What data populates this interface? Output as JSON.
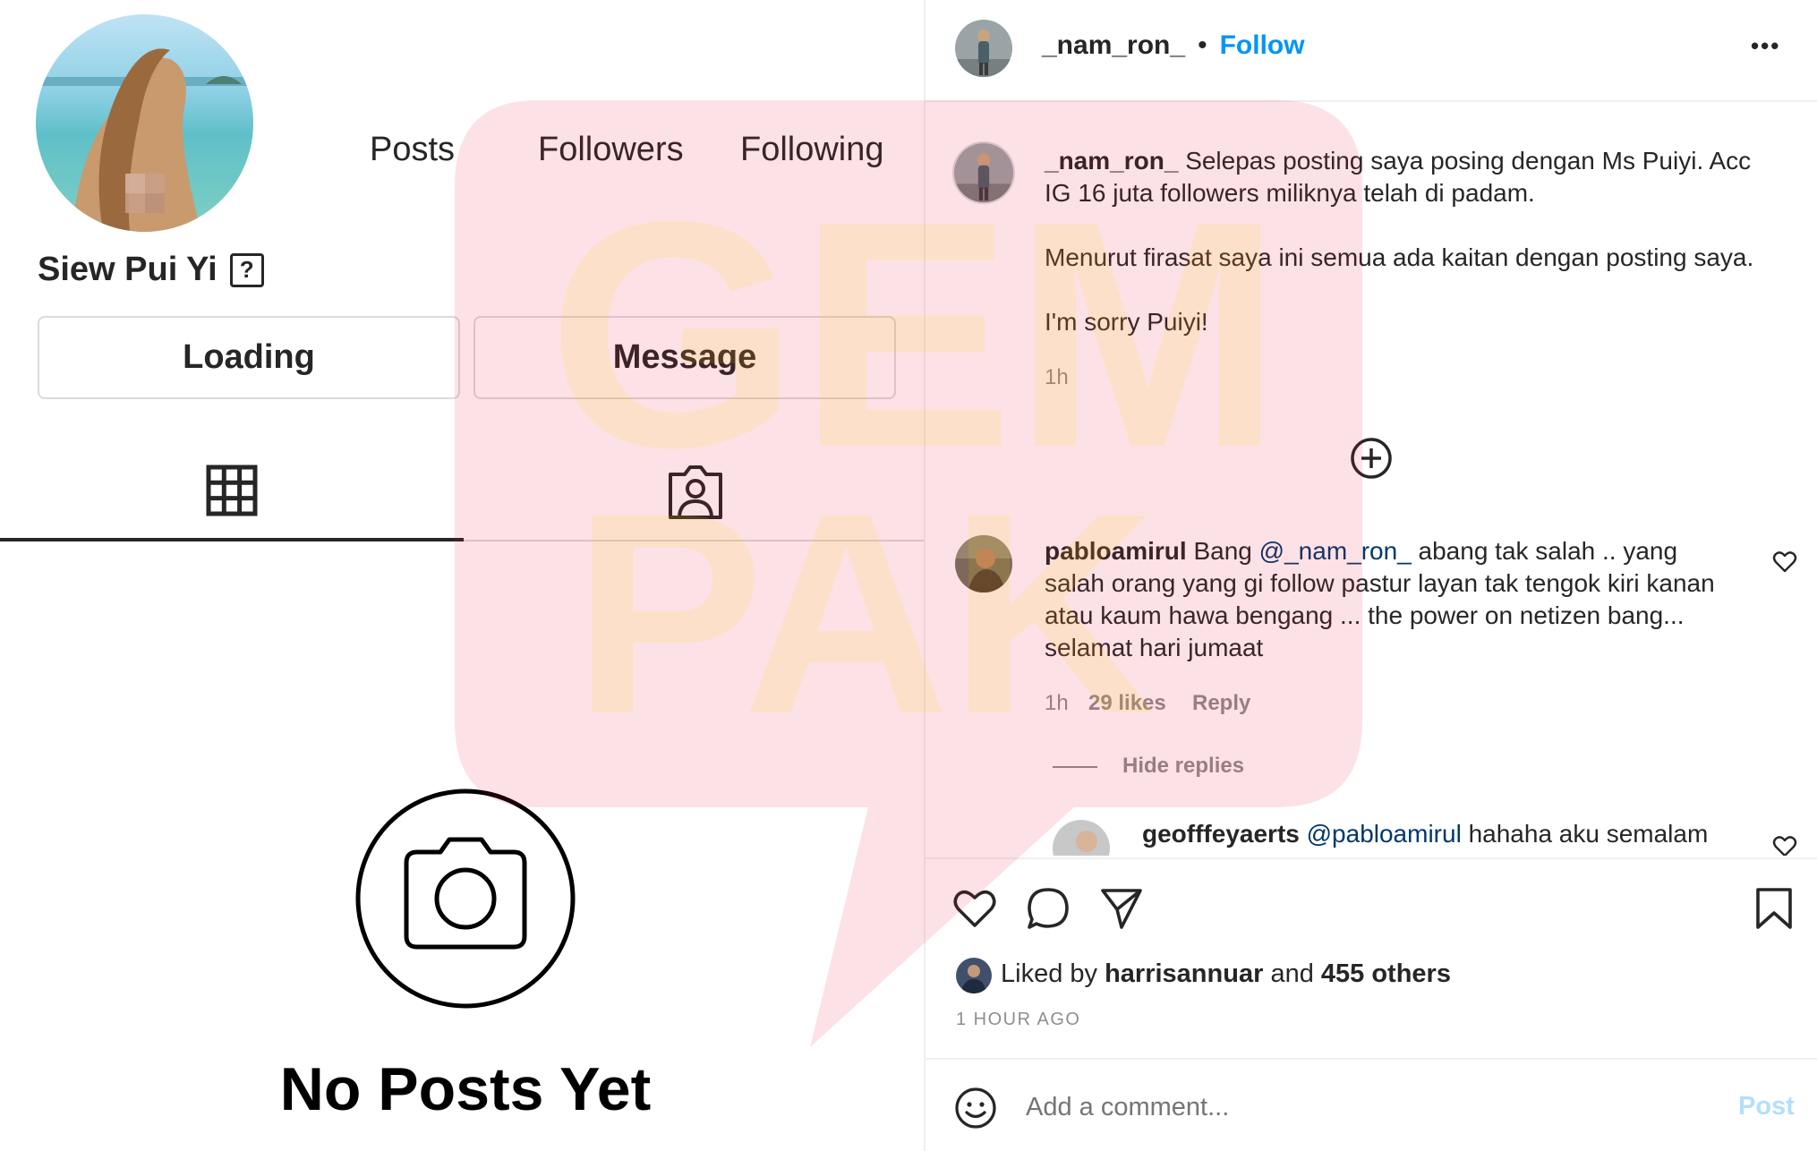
{
  "profile": {
    "name": "Siew Pui Yi",
    "help_glyph": "?",
    "stats": {
      "posts": "Posts",
      "followers": "Followers",
      "following": "Following"
    },
    "buttons": {
      "primary": "Loading",
      "message": "Message"
    },
    "tabs": [
      "posts-grid",
      "tagged"
    ],
    "empty_title": "No Posts Yet"
  },
  "post": {
    "author": "_nam_ron_",
    "separator": "•",
    "follow_label": "Follow",
    "more_label": "•••",
    "caption": {
      "username": "_nam_ron_",
      "lines": [
        "Selepas posting saya posing dengan Ms Puiyi. Acc",
        "IG 16 juta followers miliknya telah di padam."
      ],
      "paragraph2": "Menurut firasat saya ini semua ada kaitan dengan posting saya.",
      "paragraph3": "I'm sorry Puiyi!",
      "time": "1h"
    },
    "load_more_icon": "plus-circle-icon",
    "comments": [
      {
        "username": "pabloamirul",
        "prefix": "Bang",
        "mention": "@_nam_ron_",
        "line1_rest": "abang tak salah .. yang",
        "line2": "salah orang yang gi follow pastur layan tak tengok kiri kanan",
        "line3": "atau kaum hawa bengang ... the power on netizen bang...",
        "line4": "selamat hari jumaat",
        "time": "1h",
        "likes": "29 likes",
        "reply_label": "Reply",
        "hide_replies": "Hide replies"
      },
      {
        "username": "geofffeyaerts",
        "mention": "@pabloamirul",
        "text": "hahaha aku semalam"
      }
    ],
    "liked_by": {
      "prefix": "Liked by",
      "user": "harrisannuar",
      "and": "and",
      "others": "455 others"
    },
    "timestamp": "1 HOUR AGO",
    "comment_placeholder": "Add a comment...",
    "post_label": "Post"
  },
  "watermark": {
    "line1": "GEM",
    "line2": "PAK"
  },
  "colors": {
    "accent": "#0095f6",
    "mention": "#00376b",
    "muted": "#8e8e8e",
    "text": "#262626",
    "border": "#dbdbdb",
    "watermark_red": "#e8102e",
    "watermark_yellow": "#ffd400"
  }
}
